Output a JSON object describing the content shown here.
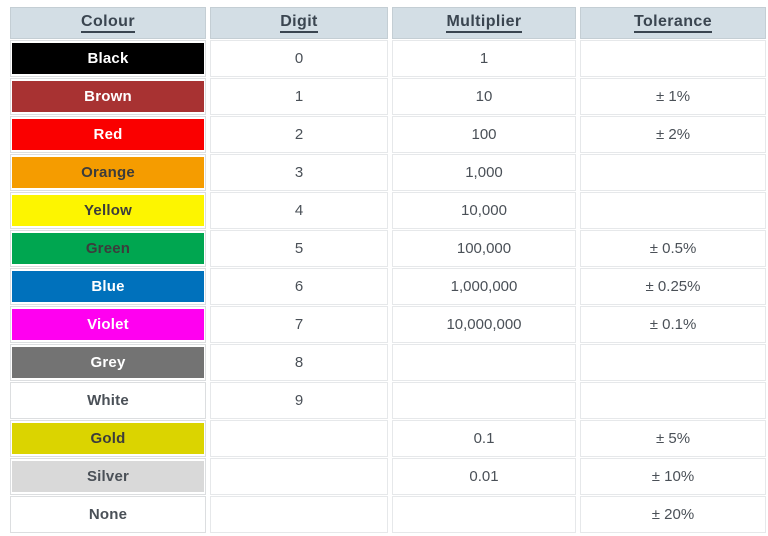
{
  "table": {
    "headers": [
      {
        "label": "Colour",
        "name": "header-colour"
      },
      {
        "label": "Digit",
        "name": "header-digit"
      },
      {
        "label": "Multiplier",
        "name": "header-multiplier"
      },
      {
        "label": "Tolerance",
        "name": "header-tolerance"
      }
    ],
    "header_bg": "#d3dee5",
    "header_text": "#3a4550",
    "rows": [
      {
        "colour": "Black",
        "swatch_bg": "#000000",
        "swatch_text": "#ffffff",
        "digit": "0",
        "multiplier": "1",
        "tolerance": ""
      },
      {
        "colour": "Brown",
        "swatch_bg": "#a83232",
        "swatch_text": "#ffffff",
        "digit": "1",
        "multiplier": "10",
        "tolerance": "± 1%"
      },
      {
        "colour": "Red",
        "swatch_bg": "#fa0000",
        "swatch_text": "#ffffff",
        "digit": "2",
        "multiplier": "100",
        "tolerance": "± 2%"
      },
      {
        "colour": "Orange",
        "swatch_bg": "#f59c00",
        "swatch_text": "#3c3c3c",
        "digit": "3",
        "multiplier": "1,000",
        "tolerance": ""
      },
      {
        "colour": "Yellow",
        "swatch_bg": "#fdf500",
        "swatch_text": "#3c3c3c",
        "digit": "4",
        "multiplier": "10,000",
        "tolerance": ""
      },
      {
        "colour": "Green",
        "swatch_bg": "#00a650",
        "swatch_text": "#3c3c3c",
        "digit": "5",
        "multiplier": "100,000",
        "tolerance": "± 0.5%"
      },
      {
        "colour": "Blue",
        "swatch_bg": "#0071bc",
        "swatch_text": "#ffffff",
        "digit": "6",
        "multiplier": "1,000,000",
        "tolerance": "± 0.25%"
      },
      {
        "colour": "Violet",
        "swatch_bg": "#ff00f0",
        "swatch_text": "#ffffff",
        "digit": "7",
        "multiplier": "10,000,000",
        "tolerance": "± 0.1%"
      },
      {
        "colour": "Grey",
        "swatch_bg": "#737373",
        "swatch_text": "#ffffff",
        "digit": "8",
        "multiplier": "",
        "tolerance": ""
      },
      {
        "colour": "White",
        "swatch_bg": "#ffffff",
        "swatch_text": "#4a5057",
        "digit": "9",
        "multiplier": "",
        "tolerance": ""
      },
      {
        "colour": "Gold",
        "swatch_bg": "#dbd400",
        "swatch_text": "#3c3c3c",
        "digit": "",
        "multiplier": "0.1",
        "tolerance": "± 5%"
      },
      {
        "colour": "Silver",
        "swatch_bg": "#d9d9d9",
        "swatch_text": "#4a5057",
        "digit": "",
        "multiplier": "0.01",
        "tolerance": "± 10%"
      },
      {
        "colour": "None",
        "swatch_bg": "#ffffff",
        "swatch_text": "#4a5057",
        "digit": "",
        "multiplier": "",
        "tolerance": "± 20%"
      }
    ]
  }
}
